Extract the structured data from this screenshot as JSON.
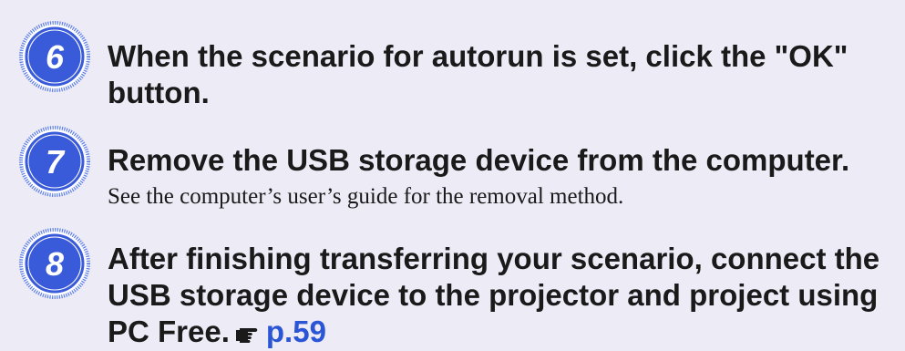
{
  "steps": [
    {
      "number": "6",
      "title": "When the scenario for autorun is set, click the \"OK\" button."
    },
    {
      "number": "7",
      "title": "Remove the USB storage device from the computer.",
      "description": "See the computer’s user’s guide for the removal method."
    },
    {
      "number": "8",
      "title": "After finishing transferring your scenario, connect the USB storage device to the projector and project using PC Free.",
      "reference": "p.59"
    }
  ],
  "icons": {
    "step_badge": "numbered-circle-icon",
    "reference": "pointing-hand-icon"
  },
  "colors": {
    "background": "#ecebf6",
    "badge_fill": "#3a5bd9",
    "badge_ring": "#6e8cf0",
    "link": "#2a55d4"
  }
}
